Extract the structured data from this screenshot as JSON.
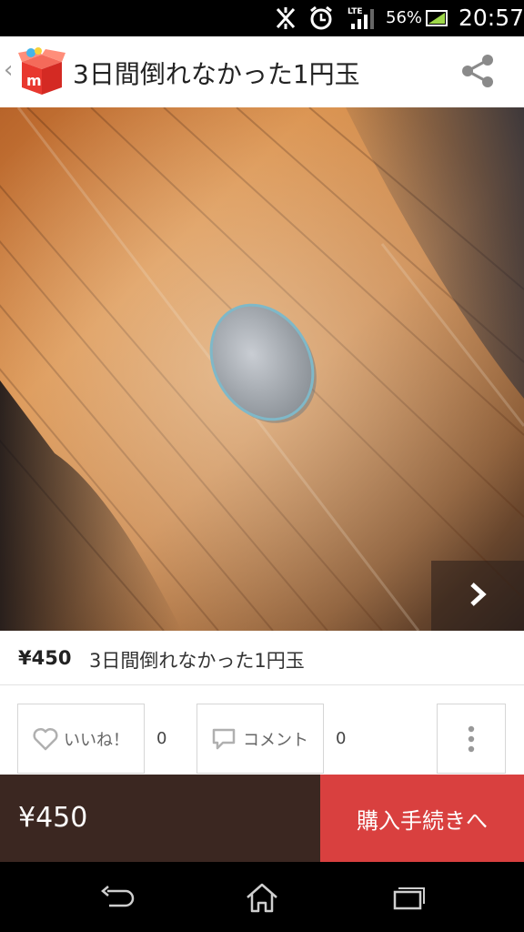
{
  "status_bar": {
    "battery_percent": "56%",
    "network_label": "LTE",
    "time": "20:57",
    "icons": [
      "muted-icon",
      "alarm-icon",
      "signal-icon",
      "battery-charging-icon"
    ]
  },
  "header": {
    "back_icon": "chevron-left-icon",
    "logo_icon": "mercari-box-logo",
    "title": "3日間倒れなかった1円玉",
    "share_icon": "share-icon"
  },
  "photo": {
    "subject": "coin-on-wooden-table",
    "next_icon": "chevron-right-icon"
  },
  "item": {
    "price": "¥450",
    "title": "3日間倒れなかった1円玉"
  },
  "actions": {
    "like_label": "いいね！",
    "like_count": "0",
    "comment_label": "コメント",
    "comment_count": "0",
    "more_icon": "more-vertical-icon"
  },
  "purchase": {
    "price": "¥450",
    "buy_label": "購入手続きへ"
  },
  "colors": {
    "buy_button": "#d9403f",
    "price_bar": "#3b2721"
  },
  "nav_bar": {
    "icons": [
      "back-icon",
      "home-icon",
      "recent-apps-icon"
    ]
  }
}
